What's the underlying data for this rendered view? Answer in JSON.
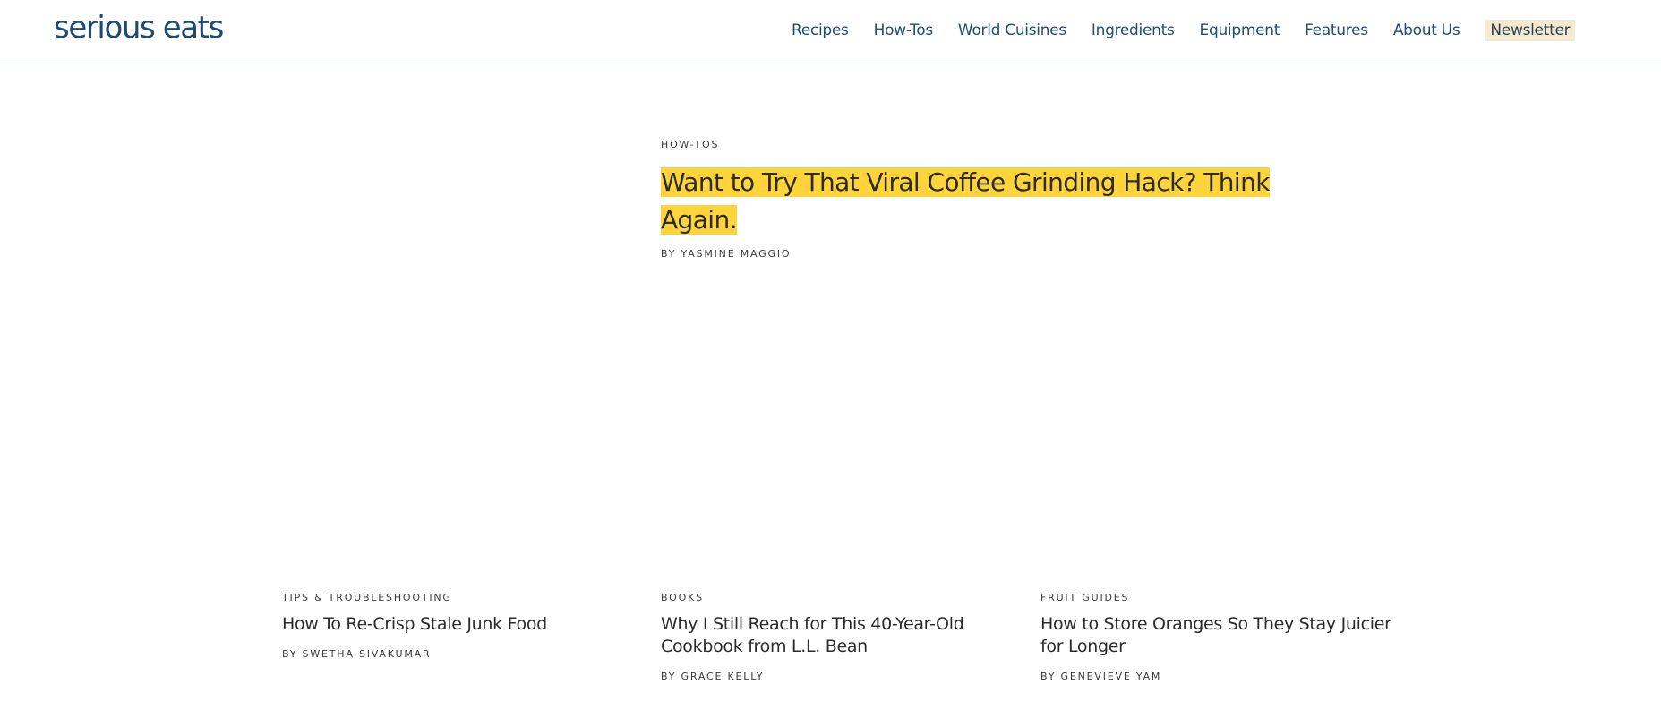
{
  "header": {
    "logo": "serious eats",
    "nav": [
      {
        "label": "Recipes"
      },
      {
        "label": "How-Tos"
      },
      {
        "label": "World Cuisines"
      },
      {
        "label": "Ingredients"
      },
      {
        "label": "Equipment"
      },
      {
        "label": "Features"
      },
      {
        "label": "About Us"
      },
      {
        "label": "Newsletter"
      }
    ]
  },
  "hero": {
    "category": "HOW-TOS",
    "title": "Want to Try That Viral Coffee Grinding Hack? Think Again.",
    "byline": "BY YASMINE MAGGIO"
  },
  "cards": [
    {
      "category": "TIPS & TROUBLESHOOTING",
      "title": "How To Re-Crisp Stale Junk Food",
      "byline": "BY SWETHA SIVAKUMAR"
    },
    {
      "category": "BOOKS",
      "title": "Why I Still Reach for This 40-Year-Old Cookbook from L.L. Bean",
      "byline": "BY GRACE KELLY"
    },
    {
      "category": "FRUIT GUIDES",
      "title": "How to Store Oranges So They Stay Juicier for Longer",
      "byline": "BY GENEVIEVE YAM"
    }
  ],
  "colors": {
    "brand_blue": "#1b4a72",
    "highlight_yellow": "#ffd43a",
    "newsletter_bg": "#f5ead0"
  }
}
